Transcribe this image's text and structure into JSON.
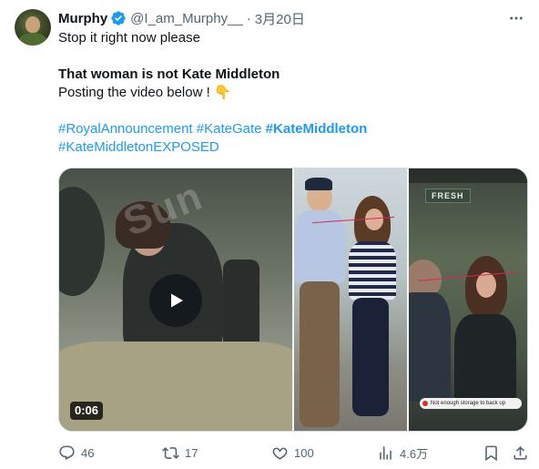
{
  "author": {
    "name": "Murphy",
    "handle": "@I_am_Murphy__",
    "separator": "·",
    "date": "3月20日"
  },
  "tweet": {
    "line1": "Stop it right now please",
    "line2": "That woman is not Kate Middleton",
    "line3": "Posting the video below ! 👇",
    "hashtags": {
      "royal_announcement": "#RoyalAnnouncement",
      "kate_gate": "#KateGate",
      "kate_middleton": "#KateMiddleton",
      "kate_middleton_exposed": "#KateMiddletonEXPOSED"
    }
  },
  "media": {
    "duration": "0:06",
    "watermark": "Sun",
    "sign_text": "FRESH",
    "toast_text": "Not enough storage to back up"
  },
  "actions": {
    "replies": "46",
    "reposts": "17",
    "likes": "100",
    "views": "4.6万"
  },
  "icons": {
    "verified": "verified-badge-icon",
    "more": "more-icon",
    "reply": "reply-icon",
    "repost": "repost-icon",
    "like": "heart-icon",
    "views": "views-icon",
    "bookmark": "bookmark-icon",
    "share": "share-icon",
    "play": "play-icon"
  },
  "colors": {
    "accent": "#1d9bf0",
    "text": "#0f1419",
    "secondary": "#536471"
  }
}
